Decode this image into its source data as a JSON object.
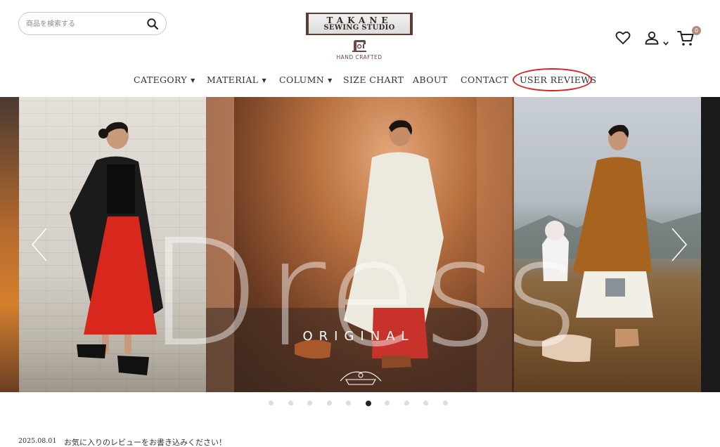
{
  "search": {
    "placeholder": "商品を検索する"
  },
  "logo": {
    "line1": "TAKANE",
    "line2": "SEWING STUDIO",
    "line3": "HAND CRAFTED"
  },
  "header": {
    "icons": [
      "heart-icon",
      "user-icon",
      "cart-icon"
    ],
    "cart_count": "0"
  },
  "nav": {
    "items": [
      {
        "label": "CATEGORY",
        "dropdown": true
      },
      {
        "label": "MATERIAL",
        "dropdown": true
      },
      {
        "label": "COLUMN",
        "dropdown": true
      },
      {
        "label": "SIZE CHART",
        "dropdown": false
      },
      {
        "label": "ABOUT",
        "dropdown": false
      },
      {
        "label": "CONTACT",
        "dropdown": false
      },
      {
        "label": "USER REVIEWS",
        "dropdown": false,
        "highlighted": true
      }
    ],
    "highlight_color": "#e02020"
  },
  "slider": {
    "headline": "Dress",
    "subtitle": "ORIGINAL",
    "slide_count": 10,
    "active_index": 5
  },
  "news": {
    "date": "2025.08.01",
    "text": "お気に入りのレビューをお書き込みください！"
  },
  "colors": {
    "text": "#333333",
    "badge": "#b08d7a",
    "logo": "#3a2a26"
  }
}
